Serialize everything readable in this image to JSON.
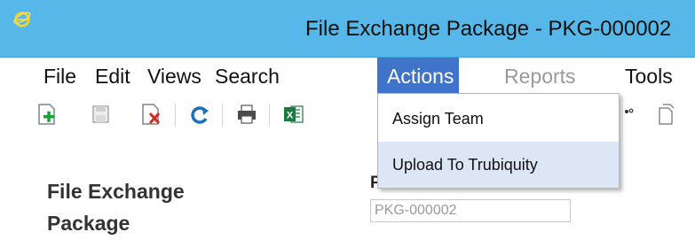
{
  "window": {
    "title": "File Exchange Package - PKG-000002"
  },
  "menubar": {
    "items": [
      {
        "label": "File"
      },
      {
        "label": "Edit"
      },
      {
        "label": "Views"
      },
      {
        "label": "Search"
      },
      {
        "label": "Actions",
        "state": "open"
      },
      {
        "label": "Reports",
        "state": "disabled"
      },
      {
        "label": "Tools"
      }
    ]
  },
  "actions_menu": {
    "items": [
      {
        "label": "Assign Team"
      },
      {
        "label": "Upload To Trubiquity",
        "state": "hovered"
      }
    ]
  },
  "toolbar": {
    "buttons": [
      {
        "icon": "new-document-icon"
      },
      {
        "icon": "save-icon"
      },
      {
        "icon": "delete-document-icon"
      },
      {
        "icon": "refresh-icon"
      },
      {
        "icon": "print-icon"
      },
      {
        "icon": "excel-export-icon"
      },
      {
        "icon": "workflow-icon"
      },
      {
        "icon": "copy-document-icon"
      }
    ]
  },
  "page": {
    "title": "File Exchange Package",
    "field_label": "P",
    "field_value": "PKG-000002"
  },
  "colors": {
    "titlebar": "#56b7e8",
    "menu_active": "#3f74c8",
    "menu_hover": "#dde6f4",
    "disabled_text": "#9a9a9a"
  }
}
